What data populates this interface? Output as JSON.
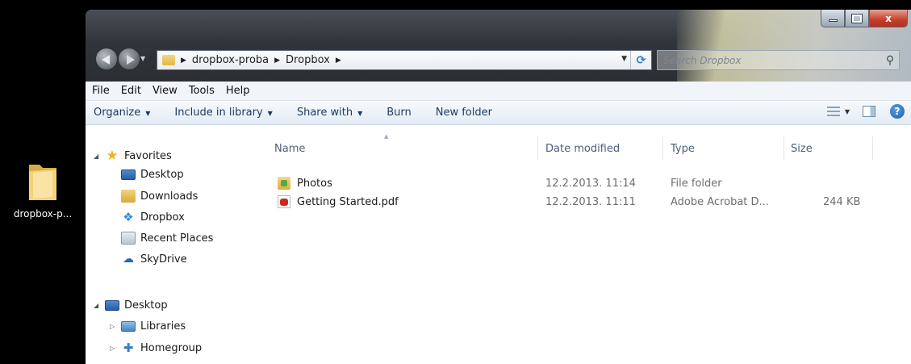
{
  "desktop": {
    "icon_label": "dropbox-p..."
  },
  "window": {
    "caption": {
      "minimize": "",
      "maximize": "",
      "close": "x"
    },
    "address": {
      "crumbs": [
        "dropbox-proba",
        "Dropbox"
      ]
    },
    "search": {
      "placeholder": "Search Dropbox"
    },
    "menu": [
      "File",
      "Edit",
      "View",
      "Tools",
      "Help"
    ],
    "commands": {
      "organize": "Organize",
      "include_in_library": "Include in library",
      "share_with": "Share with",
      "burn": "Burn",
      "new_folder": "New folder"
    },
    "nav": {
      "favorites": "Favorites",
      "favorites_items": [
        "Desktop",
        "Downloads",
        "Dropbox",
        "Recent Places",
        "SkyDrive"
      ],
      "desktop": "Desktop",
      "desktop_items": [
        "Libraries",
        "Homegroup"
      ]
    },
    "columns": {
      "name": "Name",
      "date_modified": "Date modified",
      "type": "Type",
      "size": "Size"
    },
    "files": [
      {
        "name": "Photos",
        "date": "12.2.2013. 11:14",
        "type": "File folder",
        "size": "",
        "icon": "folder-icon"
      },
      {
        "name": "Getting Started.pdf",
        "date": "12.2.2013. 11:11",
        "type": "Adobe Acrobat D...",
        "size": "244 KB",
        "icon": "pdf-icon"
      }
    ]
  }
}
